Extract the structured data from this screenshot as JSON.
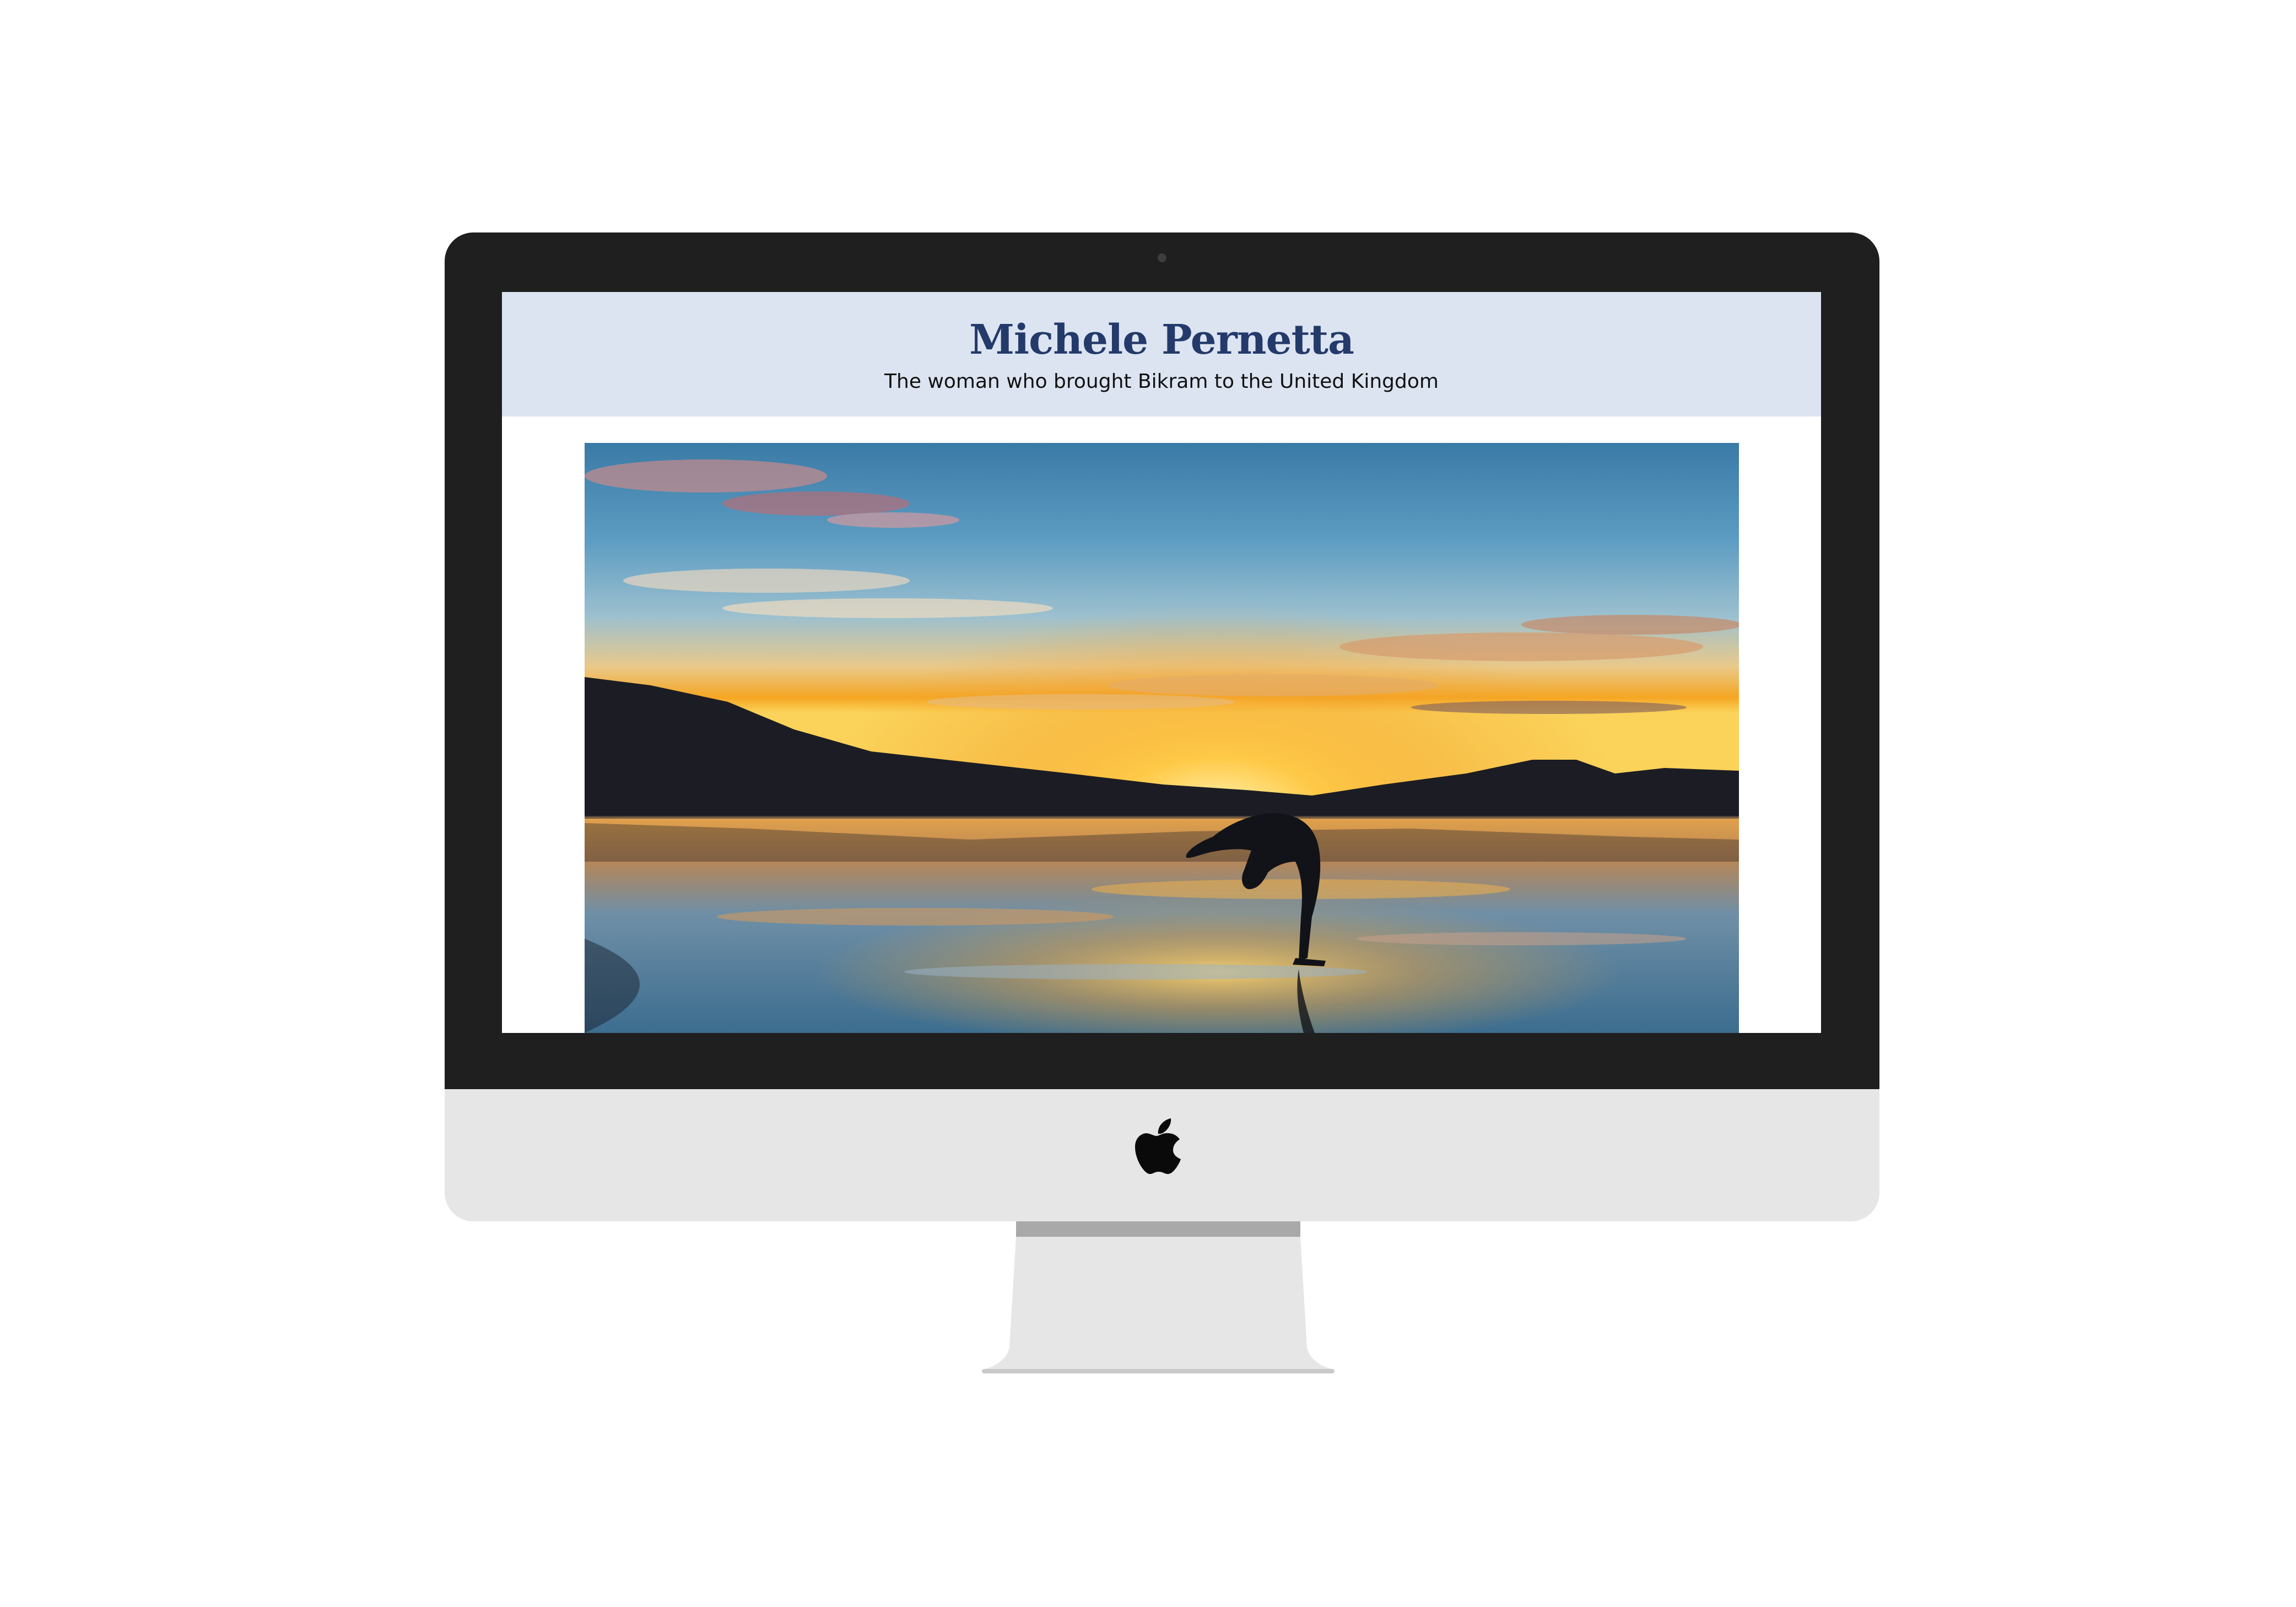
{
  "site": {
    "title": "Michele Pernetta",
    "subtitle": "The woman who brought Bikram to the United Kingdom"
  },
  "hero_image": {
    "icon": "sunset-yoga-silhouette-image"
  },
  "device": {
    "logo_icon": "apple-logo-icon"
  },
  "colors": {
    "header_bg": "#dce4f1",
    "title": "#233a6b",
    "bezel": "#1f1f1f",
    "chin": "#e6e6e6"
  }
}
